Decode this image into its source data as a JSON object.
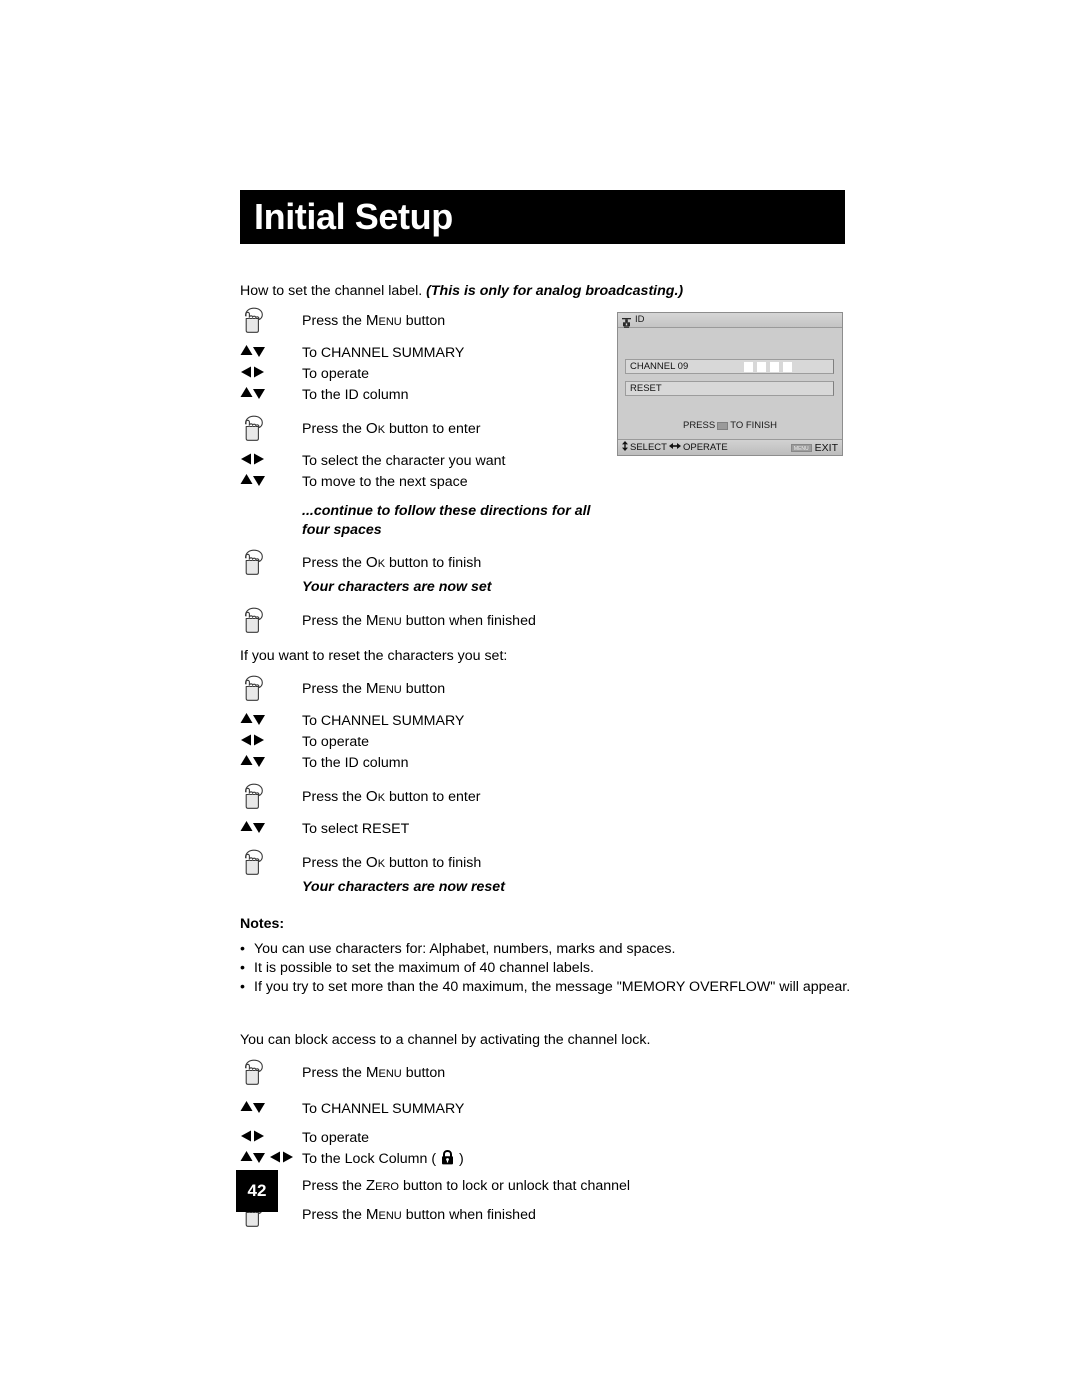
{
  "page": {
    "title": "Initial Setup",
    "number": "42"
  },
  "intro": {
    "label_text": "How to set the channel label.",
    "emphasis": "(This is only for analog broadcasting.)"
  },
  "section_set": {
    "steps": [
      {
        "icon": "hand-press-icon",
        "text_before": "Press the ",
        "keycap": "Menu",
        "text_after": " button"
      },
      {
        "icon": "up-down-arrows-icon",
        "text": "To CHANNEL SUMMARY"
      },
      {
        "icon": "left-right-arrows-icon",
        "text": "To operate"
      },
      {
        "icon": "up-down-arrows-icon",
        "text": "To the ID column"
      },
      {
        "icon": "hand-press-icon",
        "text_before": "Press the ",
        "keycap": "Ok",
        "text_after": " button to enter"
      },
      {
        "icon": "left-right-arrows-icon",
        "text": "To select the character you want"
      },
      {
        "icon": "up-down-arrows-icon",
        "text": "To move to the next space"
      }
    ],
    "continue_note": "...continue to follow these directions for all four spaces",
    "finish_step": {
      "icon": "hand-press-icon",
      "text_before": "Press the ",
      "keycap": "Ok",
      "text_after": " button to finish"
    },
    "result_note": "Your characters are now set",
    "menu_step": {
      "icon": "hand-press-icon",
      "text_before": "Press the ",
      "keycap": "Menu",
      "text_after": " button when finished"
    }
  },
  "section_reset": {
    "heading": "If you want to reset the characters you set:",
    "steps": [
      {
        "icon": "hand-press-icon",
        "text_before": "Press the ",
        "keycap": "Menu",
        "text_after": " button"
      },
      {
        "icon": "up-down-arrows-icon",
        "text": "To CHANNEL SUMMARY"
      },
      {
        "icon": "left-right-arrows-icon",
        "text": "To operate"
      },
      {
        "icon": "up-down-arrows-icon",
        "text": "To the ID column"
      },
      {
        "icon": "hand-press-icon",
        "text_before": "Press the ",
        "keycap": "Ok",
        "text_after": " button to enter"
      },
      {
        "icon": "up-down-arrows-icon",
        "text": "To select RESET"
      },
      {
        "icon": "hand-press-icon",
        "text_before": "Press the ",
        "keycap": "Ok",
        "text_after": " button to finish"
      }
    ],
    "result_note": "Your characters are now reset"
  },
  "notes": {
    "title": "Notes:",
    "bullet": "•",
    "items": [
      "You can use characters for: Alphabet, numbers, marks and spaces.",
      "It is possible to set the maximum of 40 channel labels.",
      "If you try to set more than the 40 maximum, the message \"MEMORY OVERFLOW\" will appear."
    ]
  },
  "section_lock": {
    "heading": "You can block access to a channel by activating the channel lock.",
    "steps": [
      {
        "icon": "hand-press-icon",
        "text_before": "Press the ",
        "keycap": "Menu",
        "text_after": " button"
      },
      {
        "icon": "up-down-arrows-icon",
        "text": "To CHANNEL SUMMARY"
      },
      {
        "icon": "left-right-arrows-icon",
        "text": "To operate"
      },
      {
        "icon": "up-down-left-right-arrows-icon",
        "text_before": "To the Lock Column ( ",
        "text_after": " )"
      },
      {
        "icon": "hand-press-icon",
        "text_before": "Press the ",
        "keycap": "Zero",
        "text_after": " button to lock or unlock that channel"
      },
      {
        "icon": "hand-press-icon",
        "text_before": "Press the ",
        "keycap": "Menu",
        "text_after": " button when finished"
      }
    ]
  },
  "osd": {
    "header_title": "ID",
    "header_icon": "lock-tag-icon",
    "rows": [
      {
        "label": "CHANNEL 09",
        "char_boxes": 4
      },
      {
        "label": "RESET",
        "char_boxes": 0
      }
    ],
    "finish_before": "PRESS",
    "finish_chip": "ok",
    "finish_after": "TO FINISH",
    "footer_select": "SELECT",
    "footer_operate": "OPERATE",
    "footer_menu_chip": "MENU",
    "footer_exit": "EXIT"
  },
  "colors": {
    "title_bar_bg": "#000000",
    "title_text": "#ffffff",
    "osd_bg": "#cccccc",
    "osd_row_bg": "#d8d8d8",
    "char_box": "#ffffff"
  }
}
